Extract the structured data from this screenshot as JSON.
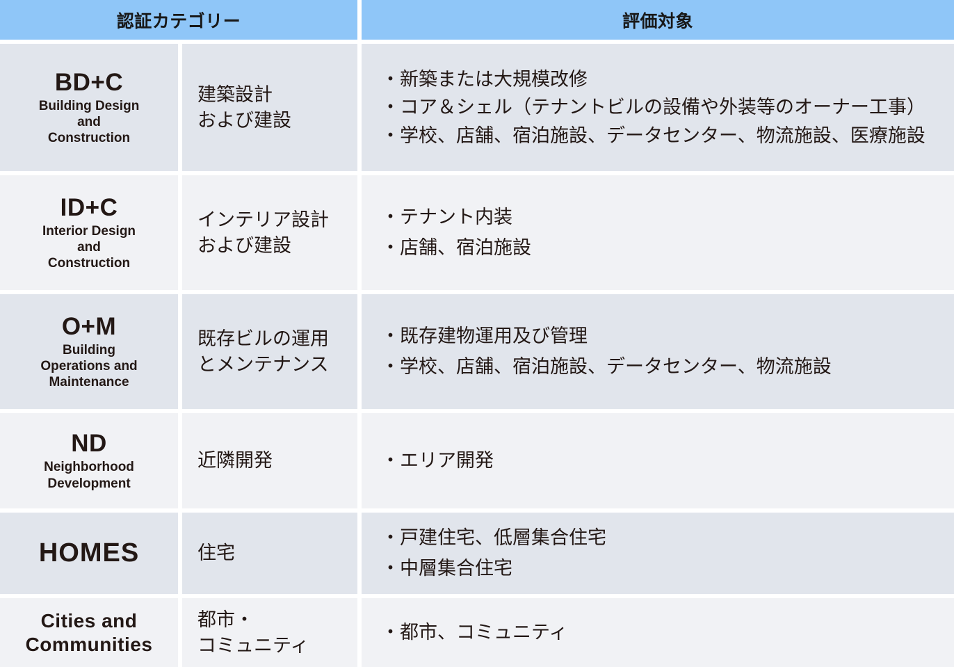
{
  "header": {
    "category_label": "認証カテゴリー",
    "target_label": "評価対象"
  },
  "colors": {
    "header_bg": "#8FC6F8",
    "row_shade_dark": "#E1E5EC",
    "row_shade_light": "#F1F2F5",
    "text": "#231815",
    "divider": "#FFFFFF"
  },
  "rows": [
    {
      "abbr": "BD+C",
      "full_name_lines": [
        "Building Design",
        "and",
        "Construction"
      ],
      "jp_name_lines": [
        "建築設計",
        "および建設"
      ],
      "targets": [
        "・新築または大規模改修",
        "・コア＆シェル（テナントビルの設備や外装等のオーナー工事）",
        "・学校、店舗、宿泊施設、データセンター、物流施設、医療施設"
      ]
    },
    {
      "abbr": "ID+C",
      "full_name_lines": [
        "Interior Design",
        "and",
        "Construction"
      ],
      "jp_name_lines": [
        "インテリア設計",
        "および建設"
      ],
      "targets": [
        "・テナント内装",
        "・店舗、宿泊施設"
      ]
    },
    {
      "abbr": "O+M",
      "full_name_lines": [
        "Building",
        "Operations and",
        "Maintenance"
      ],
      "jp_name_lines": [
        "既存ビルの運用",
        "とメンテナンス"
      ],
      "targets": [
        "・既存建物運用及び管理",
        "・学校、店舗、宿泊施設、データセンター、物流施設"
      ]
    },
    {
      "abbr": "ND",
      "full_name_lines": [
        "Neighborhood",
        "Development"
      ],
      "jp_name_lines": [
        "近隣開発"
      ],
      "targets": [
        "・エリア開発"
      ]
    },
    {
      "abbr": "HOMES",
      "full_name_lines": [],
      "jp_name_lines": [
        "住宅"
      ],
      "targets": [
        "・戸建住宅、低層集合住宅",
        "・中層集合住宅"
      ]
    },
    {
      "abbr": "Cities and\nCommunities",
      "full_name_lines": [],
      "jp_name_lines": [
        "都市・",
        "コミュニティ"
      ],
      "targets": [
        "・都市、コミュニティ"
      ]
    }
  ]
}
